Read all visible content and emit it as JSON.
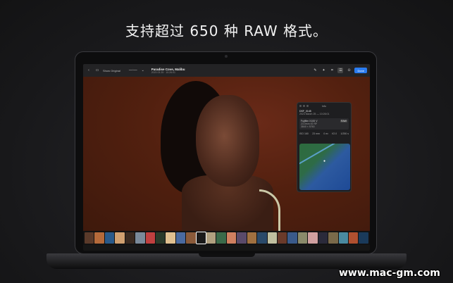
{
  "headline": "支持超过 650 种 RAW 格式。",
  "toolbar": {
    "back_label": "‹",
    "toggle_label": "Show Original",
    "title": "Paradise Cove, Malibu",
    "subtitle": "2023 03 25 · 10:26:01",
    "done_label": "Done"
  },
  "info_panel": {
    "header": "Info",
    "filename": "DSF_0145",
    "datetime": "2023 March 25 — 10:26:01",
    "camera": "Fujifilm X100 V",
    "camera_tag": "RAW",
    "lens_line1": "23.0mm f/2 RF",
    "lens_line2": "3840 × 5760",
    "stats": [
      "ISO 160",
      "23 mm",
      "0 ev",
      "f/2.0",
      "1/250 s"
    ]
  },
  "thumb_colors": [
    "#5a3a2a",
    "#b56a3a",
    "#2a5a8a",
    "#d0a070",
    "#3a2a20",
    "#7a8a9a",
    "#c04040",
    "#2a3a2a",
    "#e0c090",
    "#4a6aa0",
    "#8a5a3a",
    "#1a1a1a",
    "#b0a080",
    "#3a6a4a",
    "#d08060",
    "#5a4a6a",
    "#a07040",
    "#2a4a6a",
    "#c0c0a0",
    "#6a3a2a",
    "#3a5a8a",
    "#8a8a6a",
    "#d0a0a0",
    "#2a2a3a",
    "#7a6a4a",
    "#4a8aa0",
    "#b05030",
    "#1a3a5a"
  ],
  "watermark": "www.mac-gm.com"
}
